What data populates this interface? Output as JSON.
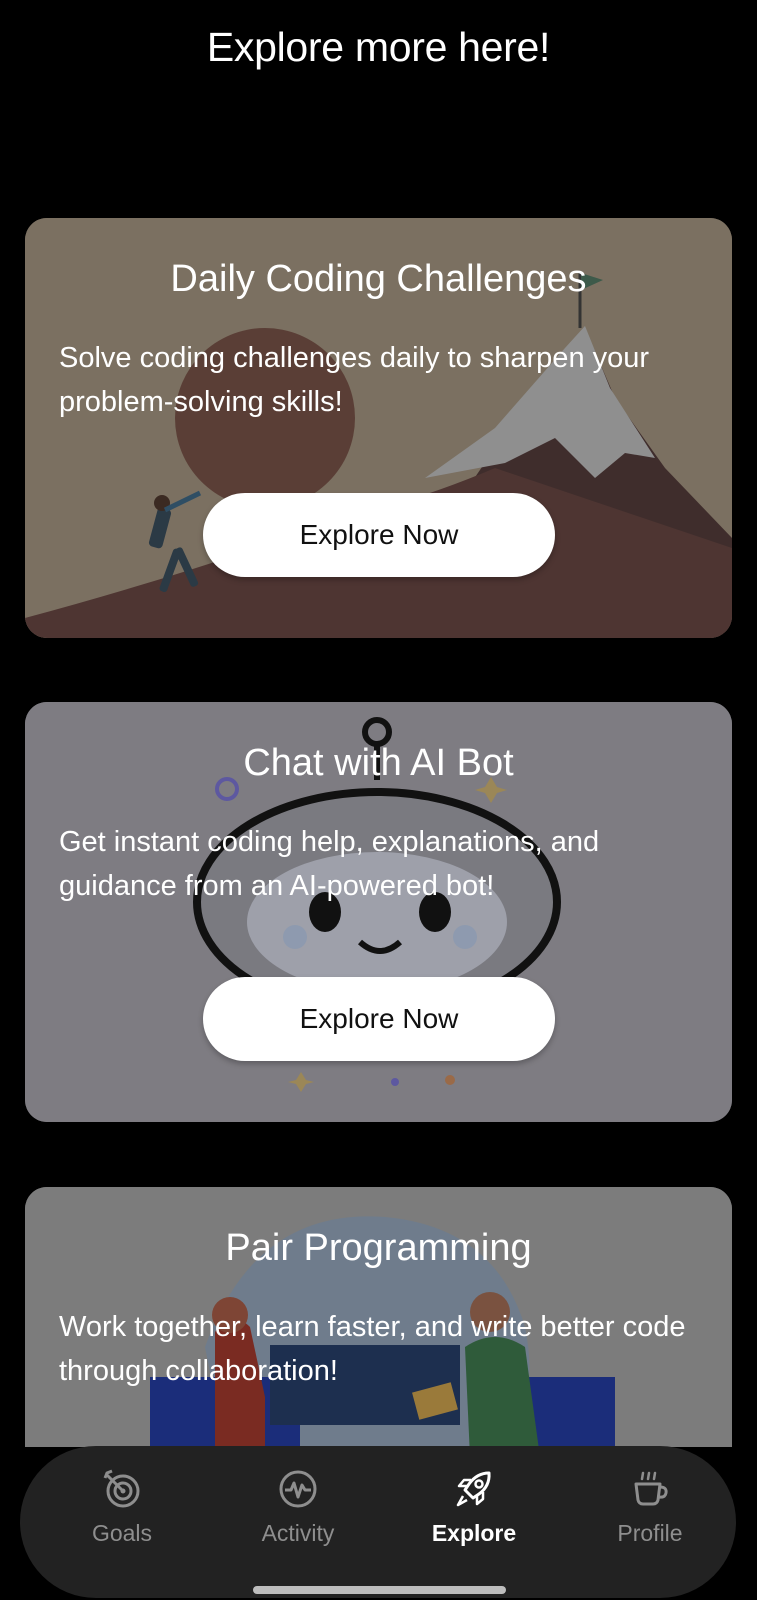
{
  "page": {
    "title": "Explore more here!"
  },
  "cards": [
    {
      "title": "Daily Coding Challenges",
      "description": "Solve coding challenges daily to sharpen your problem-solving skills!",
      "button_label": "Explore Now"
    },
    {
      "title": "Chat with AI Bot",
      "description": "Get instant coding help, explanations, and guidance from an AI-powered bot!",
      "button_label": "Explore Now"
    },
    {
      "title": "Pair Programming",
      "description": "Work together, learn faster, and write better code through collaboration!"
    }
  ],
  "nav": {
    "items": [
      {
        "label": "Goals",
        "icon": "target-icon"
      },
      {
        "label": "Activity",
        "icon": "activity-icon"
      },
      {
        "label": "Explore",
        "icon": "rocket-icon",
        "active": true
      },
      {
        "label": "Profile",
        "icon": "coffee-icon"
      }
    ]
  },
  "colors": {
    "background": "#000000",
    "nav_background": "#222222",
    "active_label": "#ffffff",
    "inactive_label": "#8e8e8e"
  }
}
